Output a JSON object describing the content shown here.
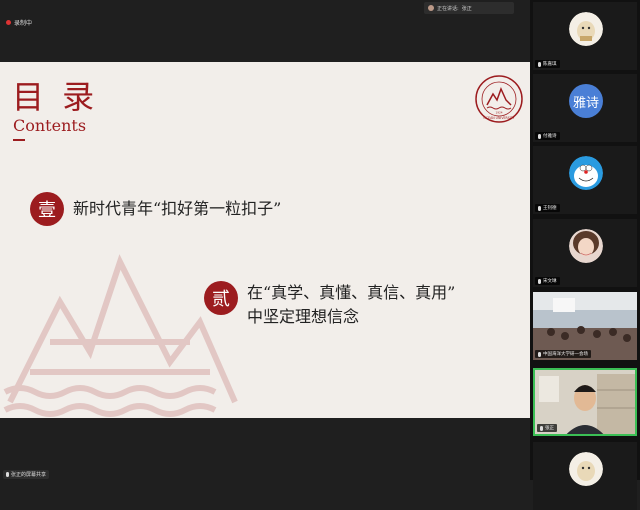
{
  "app": {
    "recording_label": "录制中",
    "speaking_label": "正在讲话:",
    "speaking_name": "张正"
  },
  "slide": {
    "title": "目 录",
    "subtitle": "Contents",
    "items": [
      {
        "badge": "壹",
        "lines": [
          "新时代青年“扣好第一粒扣子”"
        ]
      },
      {
        "badge": "贰",
        "lines": [
          "在“真学、真懂、真信、真用”",
          "中坚定理想信念"
        ]
      }
    ],
    "logo_text": "OCEAN UNIVERSITY",
    "logo_year": "1924"
  },
  "screen_share": {
    "mic_label": "张正的屏幕共享"
  },
  "participants": [
    {
      "name": "陈嘉琪",
      "avatar": "cartoon"
    },
    {
      "name": "付雅诗",
      "avatar": "text",
      "avatar_text": "雅诗"
    },
    {
      "name": "王钊德",
      "avatar": "doraemon"
    },
    {
      "name": "宋文琳",
      "avatar": "photo"
    },
    {
      "name": "中国海洋大学研一会场",
      "avatar": "camera-room"
    },
    {
      "name": "张正",
      "avatar": "camera-person",
      "active": true
    },
    {
      "name": "",
      "avatar": "cartoon"
    }
  ],
  "colors": {
    "accent": "#9c1c1f",
    "active_border": "#3bbf55",
    "text_avatar": "#4a7fd6"
  }
}
